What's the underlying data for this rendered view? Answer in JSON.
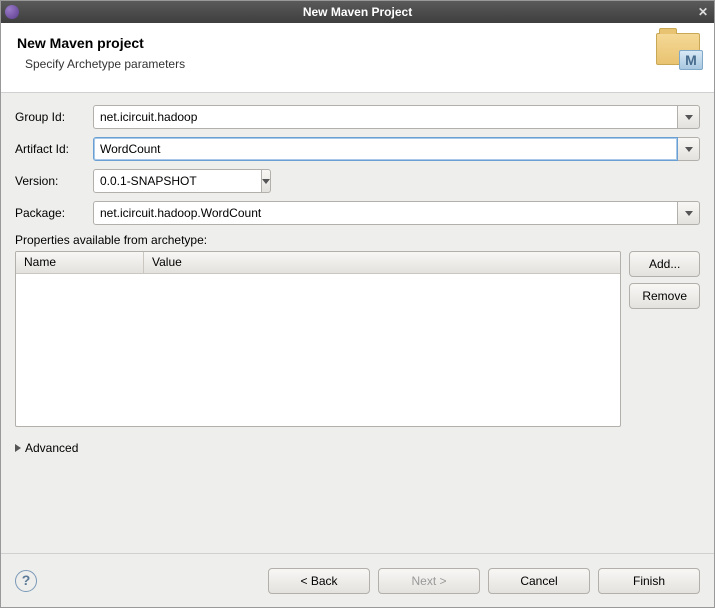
{
  "window": {
    "title": "New Maven Project"
  },
  "header": {
    "title": "New Maven project",
    "subtitle": "Specify Archetype parameters"
  },
  "form": {
    "groupId": {
      "label": "Group Id:",
      "value": "net.icircuit.hadoop"
    },
    "artifactId": {
      "label": "Artifact Id:",
      "value": "WordCount"
    },
    "version": {
      "label": "Version:",
      "value": "0.0.1-SNAPSHOT"
    },
    "package": {
      "label": "Package:",
      "value": "net.icircuit.hadoop.WordCount"
    }
  },
  "properties": {
    "heading": "Properties available from archetype:",
    "columns": {
      "name": "Name",
      "value": "Value"
    },
    "addLabel": "Add...",
    "removeLabel": "Remove"
  },
  "advancedLabel": "Advanced",
  "footer": {
    "back": "< Back",
    "next": "Next >",
    "cancel": "Cancel",
    "finish": "Finish",
    "help": "?"
  }
}
